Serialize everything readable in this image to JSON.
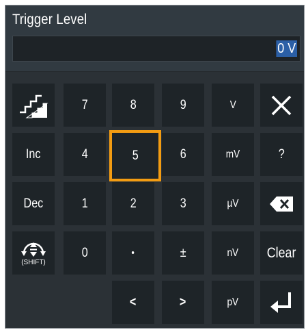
{
  "dialog": {
    "title": "Trigger Level",
    "value": "0 V"
  },
  "keys": {
    "step": "step-icon",
    "k7": "7",
    "k8": "8",
    "k9": "9",
    "unit_v": "V",
    "close": "close-icon",
    "inc": "Inc",
    "k4": "4",
    "k5": "5",
    "k6": "6",
    "unit_mv": "mV",
    "help": "?",
    "dec": "Dec",
    "k1": "1",
    "k2": "2",
    "k3": "3",
    "unit_uv": "µV",
    "backspace": "backspace-icon",
    "shift_label": "(SHIFT)",
    "k0": "0",
    "dot": "•",
    "plusminus": "±",
    "unit_nv": "nV",
    "clear": "Clear",
    "left": "<",
    "right": ">",
    "unit_pv": "pV",
    "enter": "enter-icon"
  },
  "colors": {
    "frame": "#2b3136",
    "key": "#1e2428",
    "focus": "#f39c12",
    "selection": "#2b5fa6"
  }
}
